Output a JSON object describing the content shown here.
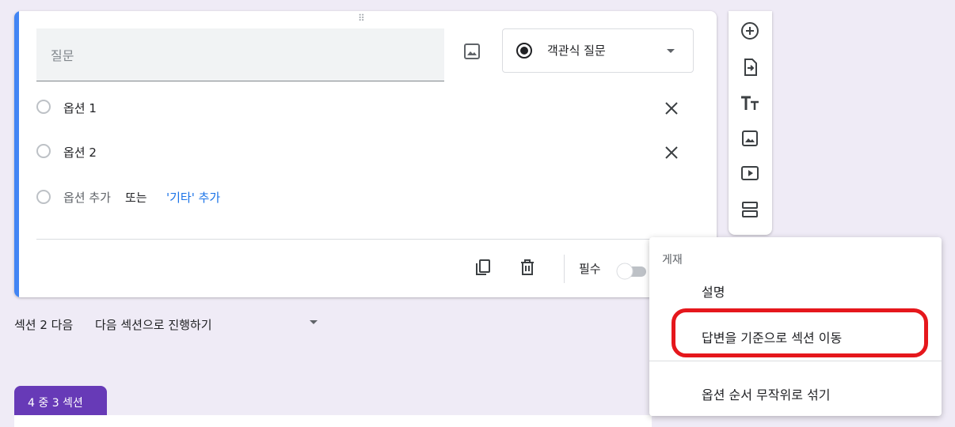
{
  "question": {
    "placeholder": "질문",
    "type_label": "객관식 질문",
    "options": [
      "옵션 1",
      "옵션 2"
    ],
    "add_option": "옵션 추가",
    "or_text": "또는",
    "add_other": "'기타' 추가"
  },
  "footer": {
    "required_label": "필수",
    "required_on": false
  },
  "section_nav": {
    "label": "섹션 2 다음",
    "value": "다음 섹션으로 진행하기"
  },
  "section_badge": "4 중 3 섹션",
  "menu": {
    "header": "게재",
    "items": [
      "설명",
      "답변을 기준으로 섹션 이동",
      "옵션 순서 무작위로 섞기"
    ],
    "highlighted_index": 1
  },
  "colors": {
    "accent": "#4285f4",
    "section_purple": "#673ab7",
    "highlight_red": "#e5171c",
    "link_blue": "#1a73e8"
  },
  "icons": {
    "toolbar": [
      "add-question-icon",
      "import-questions-icon",
      "add-title-icon",
      "add-image-icon",
      "add-video-icon",
      "add-section-icon"
    ]
  }
}
